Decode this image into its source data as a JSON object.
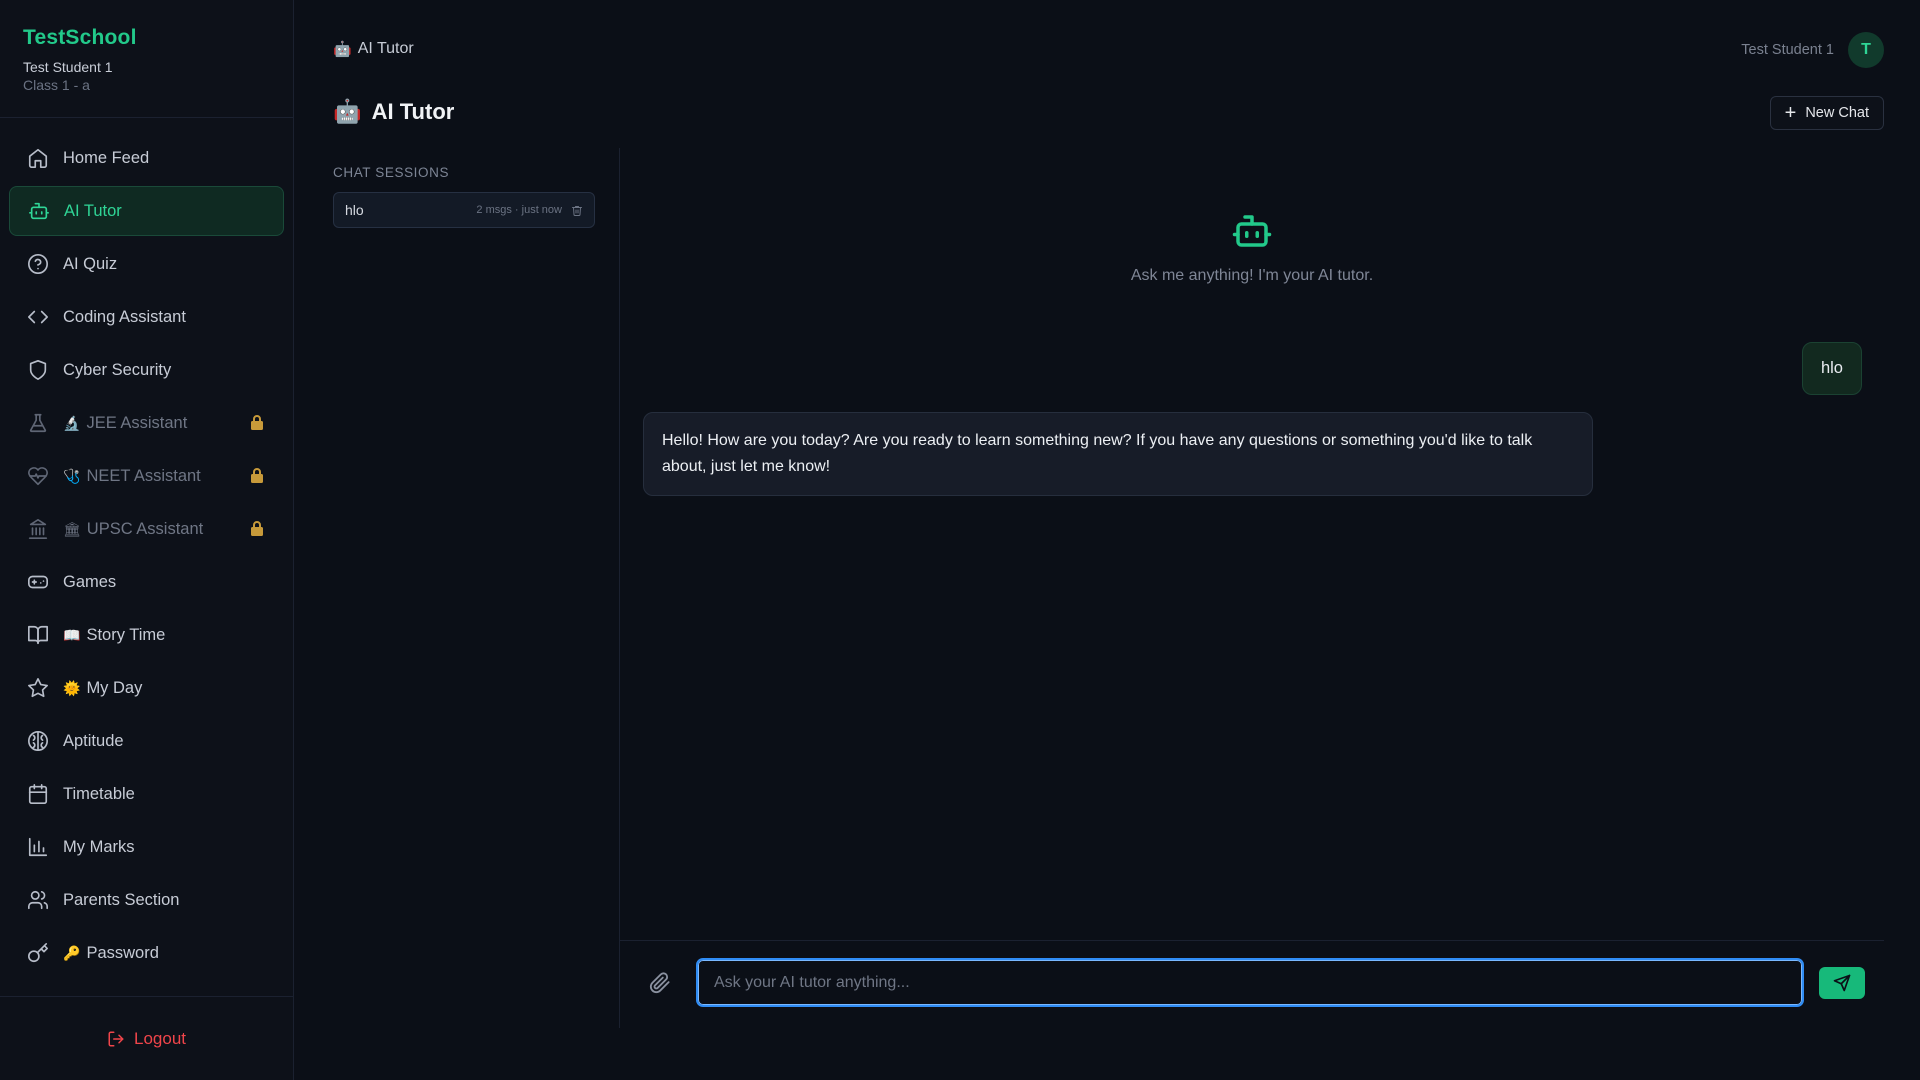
{
  "brand": {
    "title": "TestSchool",
    "user": "Test Student 1",
    "class": "Class 1 - a"
  },
  "nav": [
    {
      "label": "Home Feed",
      "icon": "home-icon",
      "emoji": "",
      "state": "normal"
    },
    {
      "label": "AI Tutor",
      "icon": "bot-icon",
      "emoji": "",
      "state": "active"
    },
    {
      "label": "AI Quiz",
      "icon": "help-circle-icon",
      "emoji": "",
      "state": "normal"
    },
    {
      "label": "Coding Assistant",
      "icon": "code-icon",
      "emoji": "",
      "state": "normal"
    },
    {
      "label": "Cyber Security",
      "icon": "shield-icon",
      "emoji": "",
      "state": "normal"
    },
    {
      "label": "JEE Assistant",
      "icon": "flask-icon",
      "emoji": "🔬",
      "state": "locked"
    },
    {
      "label": "NEET Assistant",
      "icon": "heart-pulse-icon",
      "emoji": "🩺",
      "state": "locked"
    },
    {
      "label": "UPSC Assistant",
      "icon": "landmark-icon",
      "emoji": "🏛",
      "state": "locked"
    },
    {
      "label": "Games",
      "icon": "gamepad-icon",
      "emoji": "",
      "state": "normal"
    },
    {
      "label": "Story Time",
      "icon": "book-open-icon",
      "emoji": "📖",
      "state": "normal"
    },
    {
      "label": "My Day",
      "icon": "star-icon",
      "emoji": "🌞",
      "state": "normal"
    },
    {
      "label": "Aptitude",
      "icon": "brain-icon",
      "emoji": "",
      "state": "normal"
    },
    {
      "label": "Timetable",
      "icon": "calendar-icon",
      "emoji": "",
      "state": "normal"
    },
    {
      "label": "My Marks",
      "icon": "bar-chart-icon",
      "emoji": "",
      "state": "normal"
    },
    {
      "label": "Parents Section",
      "icon": "users-icon",
      "emoji": "",
      "state": "normal"
    },
    {
      "label": "Password",
      "icon": "key-icon",
      "emoji": "🔑",
      "state": "normal"
    }
  ],
  "logout_label": "Logout",
  "header": {
    "breadcrumb_emoji": "🤖",
    "breadcrumb": "AI Tutor",
    "user_name": "Test Student 1",
    "avatar_initial": "T"
  },
  "page": {
    "title_emoji": "🤖",
    "title": "AI Tutor",
    "new_chat_label": "New Chat"
  },
  "sessions": {
    "heading": "CHAT SESSIONS",
    "items": [
      {
        "name": "hlo",
        "meta": "2 msgs · just now"
      }
    ]
  },
  "chat": {
    "welcome": "Ask me anything! I'm your AI tutor.",
    "user_message": "hlo",
    "bot_message": "Hello! How are you today? Are you ready to learn something new? If you have any questions or something you'd like to talk about, just let me know!"
  },
  "composer": {
    "placeholder": "Ask your AI tutor anything...",
    "value": ""
  },
  "colors": {
    "accent": "#22c98a",
    "background": "#0b0f17",
    "danger": "#f0454a",
    "focus": "#2f8cf5"
  }
}
